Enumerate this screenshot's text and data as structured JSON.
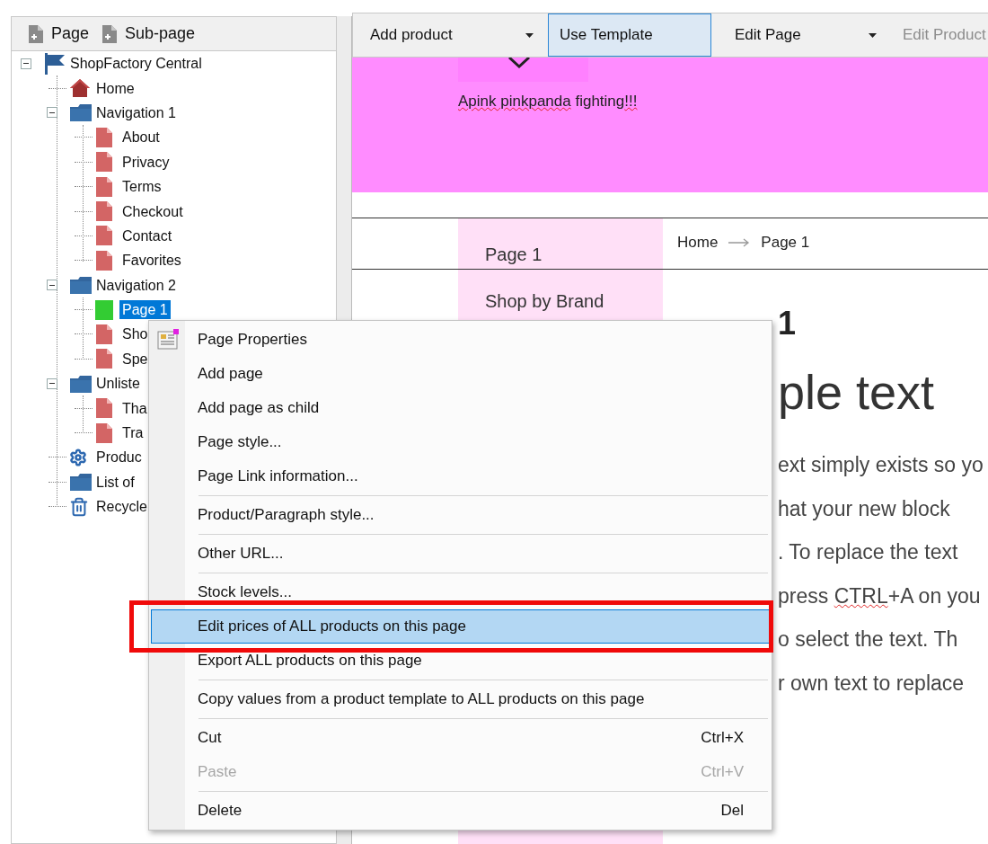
{
  "left_panel": {
    "toolbar": [
      {
        "label": "Page"
      },
      {
        "label": "Sub-page"
      }
    ],
    "tree": [
      {
        "label": "ShopFactory Central",
        "kind": "root",
        "selected": false,
        "expanded": true,
        "children": [
          {
            "label": "Home",
            "kind": "home",
            "selected": false
          },
          {
            "label": "Navigation 1",
            "kind": "folder",
            "selected": false,
            "expanded": true,
            "children": [
              {
                "label": "About",
                "kind": "page",
                "selected": false
              },
              {
                "label": "Privacy",
                "kind": "page",
                "selected": false
              },
              {
                "label": "Terms",
                "kind": "page",
                "selected": false
              },
              {
                "label": "Checkout",
                "kind": "page",
                "selected": false
              },
              {
                "label": "Contact",
                "kind": "page",
                "selected": false
              },
              {
                "label": "Favorites",
                "kind": "page",
                "selected": false
              }
            ]
          },
          {
            "label": "Navigation 2",
            "kind": "folder",
            "selected": false,
            "expanded": true,
            "children": [
              {
                "label": "Page 1",
                "kind": "current",
                "selected": true
              },
              {
                "label": "Sho",
                "kind": "page",
                "selected": false
              },
              {
                "label": "Spe",
                "kind": "page",
                "selected": false
              }
            ]
          },
          {
            "label": "Unliste",
            "kind": "folder",
            "selected": false,
            "expanded": true,
            "children": [
              {
                "label": "Tha",
                "kind": "page",
                "selected": false
              },
              {
                "label": "Tra",
                "kind": "page",
                "selected": false
              }
            ]
          },
          {
            "label": "Produc",
            "kind": "settings",
            "selected": false
          },
          {
            "label": "List of",
            "kind": "folder",
            "selected": false
          },
          {
            "label": "Recycle",
            "kind": "recycle",
            "selected": false
          }
        ]
      }
    ]
  },
  "toolbar": [
    {
      "label": "Add product",
      "dropdown": true,
      "selected": false,
      "disabled": false
    },
    {
      "label": "Use Template",
      "dropdown": false,
      "selected": true,
      "disabled": false
    },
    {
      "label": "Edit Page",
      "dropdown": true,
      "selected": false,
      "disabled": false
    },
    {
      "label": "Edit Product",
      "dropdown": false,
      "selected": false,
      "disabled": true
    }
  ],
  "banner": {
    "segments": [
      {
        "text": "Apink pinkpanda",
        "misspelled": true
      },
      {
        "text": " fighting",
        "misspelled": false
      },
      {
        "text": "!!!",
        "misspelled": true
      }
    ]
  },
  "nav": [
    {
      "label": "Page 1"
    },
    {
      "label": "Shop by Brand"
    }
  ],
  "breadcrumb": [
    {
      "label": "Home"
    },
    {
      "label": "Page 1"
    }
  ],
  "page": {
    "heading": "1",
    "subheading": "ple text",
    "lines": [
      {
        "segments": [
          {
            "text": "ext simply exists so yo",
            "misspelled": false
          }
        ]
      },
      {
        "segments": [
          {
            "text": "hat your new block",
            "misspelled": false
          }
        ]
      },
      {
        "segments": [
          {
            "text": ". To replace the text",
            "misspelled": false
          }
        ]
      },
      {
        "segments": [
          {
            "text": "press ",
            "misspelled": false
          },
          {
            "text": "CTRL",
            "misspelled": true
          },
          {
            "text": "+A on you",
            "misspelled": false
          }
        ]
      },
      {
        "segments": [
          {
            "text": "o select the text. Th",
            "misspelled": false
          }
        ]
      },
      {
        "segments": [
          {
            "text": "r own text to replace",
            "misspelled": false
          }
        ]
      }
    ]
  },
  "context_menu": {
    "items": [
      {
        "kind": "item",
        "label": "Page Properties",
        "has_icon": true,
        "selected": false,
        "disabled": false,
        "boxed": false
      },
      {
        "kind": "item",
        "label": "Add page",
        "selected": false,
        "disabled": false,
        "boxed": false
      },
      {
        "kind": "item",
        "label": "Add page as child",
        "selected": false,
        "disabled": false,
        "boxed": false
      },
      {
        "kind": "item",
        "label": "Page style...",
        "selected": false,
        "disabled": false,
        "boxed": false
      },
      {
        "kind": "item",
        "label": "Page Link information...",
        "selected": false,
        "disabled": false,
        "boxed": false
      },
      {
        "kind": "separator"
      },
      {
        "kind": "item",
        "label": "Product/Paragraph style...",
        "selected": false,
        "disabled": false,
        "boxed": false
      },
      {
        "kind": "separator"
      },
      {
        "kind": "item",
        "label": "Other URL...",
        "selected": false,
        "disabled": false,
        "boxed": false
      },
      {
        "kind": "separator"
      },
      {
        "kind": "item",
        "label": "Stock levels...",
        "selected": false,
        "disabled": false,
        "boxed": false
      },
      {
        "kind": "item",
        "label": "Edit prices of ALL products on this page",
        "selected": true,
        "disabled": false,
        "boxed": true
      },
      {
        "kind": "item",
        "label": "Export ALL products on this page",
        "selected": false,
        "disabled": false,
        "boxed": false
      },
      {
        "kind": "separator"
      },
      {
        "kind": "item",
        "label": "Copy values from a product template to ALL products on this page",
        "selected": false,
        "disabled": false,
        "boxed": false
      },
      {
        "kind": "separator"
      },
      {
        "kind": "item",
        "label": "Cut",
        "shortcut": "Ctrl+X",
        "selected": false,
        "disabled": false,
        "boxed": false
      },
      {
        "kind": "item",
        "label": "Paste",
        "shortcut": "Ctrl+V",
        "selected": false,
        "disabled": true,
        "boxed": false
      },
      {
        "kind": "separator"
      },
      {
        "kind": "item",
        "label": "Delete",
        "shortcut": "Del",
        "selected": false,
        "disabled": false,
        "boxed": false
      }
    ]
  }
}
